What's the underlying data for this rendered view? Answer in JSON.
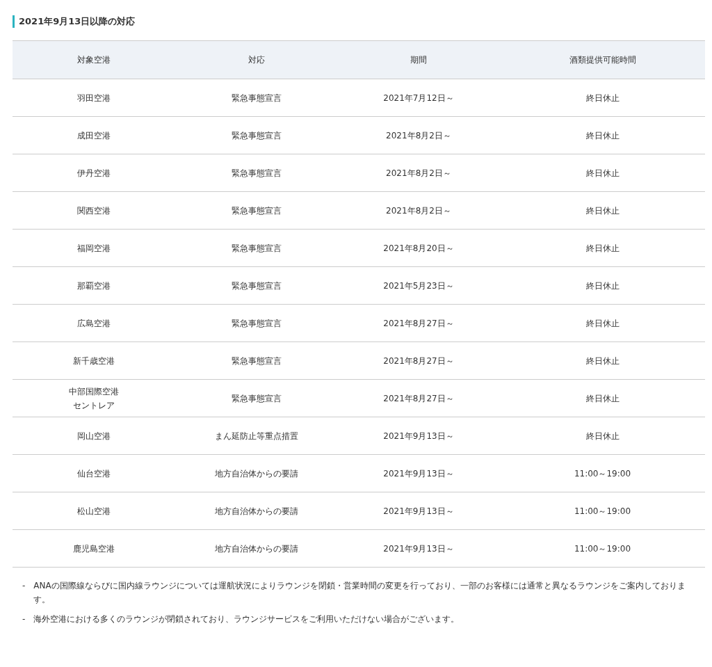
{
  "heading": "2021年9月13日以降の対応",
  "table": {
    "columns": [
      "対象空港",
      "対応",
      "期間",
      "酒類提供可能時間"
    ],
    "rows": [
      [
        "羽田空港",
        "緊急事態宣言",
        "2021年7月12日～",
        "終日休止"
      ],
      [
        "成田空港",
        "緊急事態宣言",
        "2021年8月2日～",
        "終日休止"
      ],
      [
        "伊丹空港",
        "緊急事態宣言",
        "2021年8月2日～",
        "終日休止"
      ],
      [
        "関西空港",
        "緊急事態宣言",
        "2021年8月2日～",
        "終日休止"
      ],
      [
        "福岡空港",
        "緊急事態宣言",
        "2021年8月20日～",
        "終日休止"
      ],
      [
        "那覇空港",
        "緊急事態宣言",
        "2021年5月23日～",
        "終日休止"
      ],
      [
        "広島空港",
        "緊急事態宣言",
        "2021年8月27日～",
        "終日休止"
      ],
      [
        "新千歳空港",
        "緊急事態宣言",
        "2021年8月27日～",
        "終日休止"
      ],
      [
        "中部国際空港セントレア",
        "緊急事態宣言",
        "2021年8月27日～",
        "終日休止"
      ],
      [
        "岡山空港",
        "まん延防止等重点措置",
        "2021年9月13日～",
        "終日休止"
      ],
      [
        "仙台空港",
        "地方自治体からの要請",
        "2021年9月13日～",
        "11:00～19:00"
      ],
      [
        "松山空港",
        "地方自治体からの要請",
        "2021年9月13日～",
        "11:00～19:00"
      ],
      [
        "鹿児島空港",
        "地方自治体からの要請",
        "2021年9月13日～",
        "11:00～19:00"
      ]
    ]
  },
  "notes": [
    {
      "marker": "-",
      "text": "ANAの国際線ならびに国内線ラウンジについては運航状況によりラウンジを閉鎖・営業時間の変更を行っており、一部のお客様には通常と異なるラウンジをご案内しております。"
    },
    {
      "marker": "-",
      "text": "海外空港における多くのラウンジが閉鎖されており、ラウンジサービスをご利用いただけない場合がございます。"
    }
  ]
}
